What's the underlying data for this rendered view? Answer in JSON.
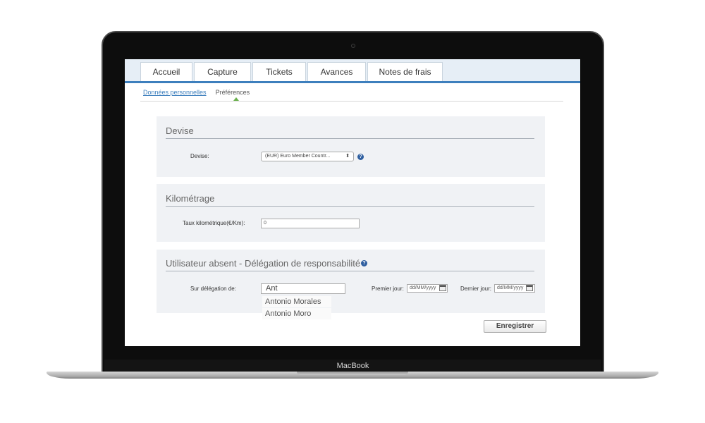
{
  "device": {
    "brand": "MacBook"
  },
  "tabs": [
    {
      "label": "Accueil"
    },
    {
      "label": "Capture"
    },
    {
      "label": "Tickets"
    },
    {
      "label": "Avances"
    },
    {
      "label": "Notes de frais"
    }
  ],
  "subnav": {
    "personal": "Données personnelles",
    "preferences": "Préférences"
  },
  "devise": {
    "title": "Devise",
    "label": "Devise:",
    "value": "(EUR) Euro Member Countr...",
    "arrows": "⬍"
  },
  "kilometrage": {
    "title": "Kilométrage",
    "label": "Taux kilométrique(€/Km):",
    "value": "0"
  },
  "delegation": {
    "title": "Utilisateur absent - Délégation de responsabilité",
    "label": "Sur délégation de:",
    "value": "Ant",
    "suggestions": [
      "Antonio Morales",
      "Antonio Moro"
    ],
    "first_day_label": "Premier jour:",
    "first_day_placeholder": "dd/MM/yyyy",
    "last_day_label": "Dernier jour:",
    "last_day_placeholder": "dd/MM/yyyy"
  },
  "help_glyph": "?",
  "actions": {
    "save": "Enregistrer"
  }
}
